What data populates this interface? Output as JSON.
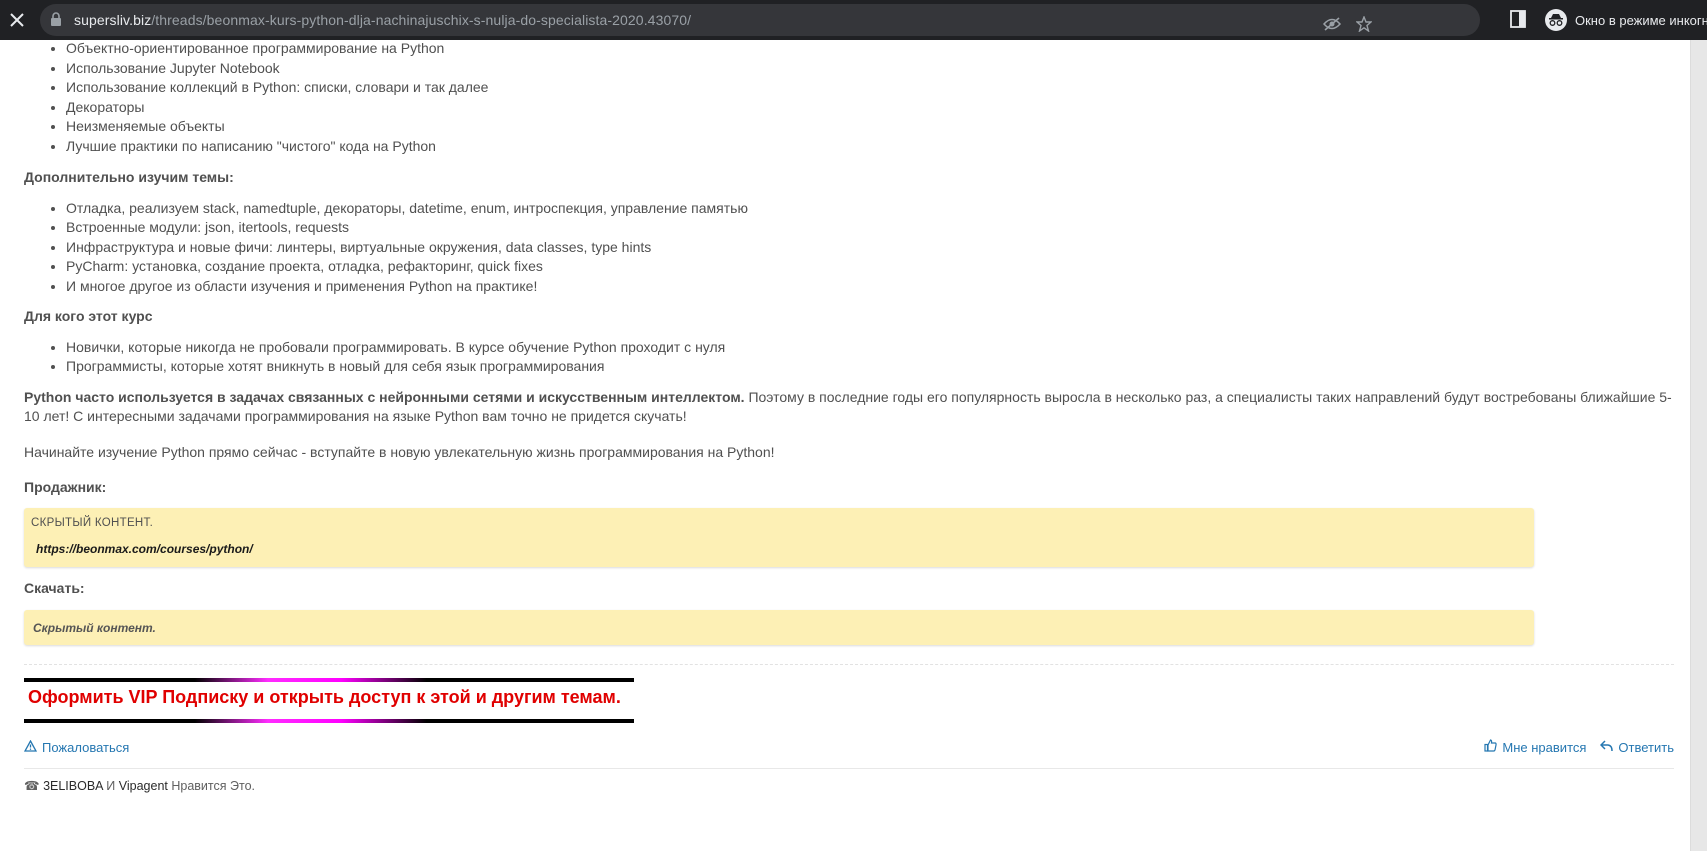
{
  "browser": {
    "url_host": "supersliv.biz",
    "url_path": "/threads/beonmax-kurs-python-dlja-nachinajuschix-s-nulja-do-specialista-2020.43070/",
    "incognito_label": "Окно в режиме инкогни"
  },
  "article": {
    "list1": [
      "Объектно-ориентированное программирование на Python",
      "Использование Jupyter Notebook",
      "Использование коллекций в Python: списки, словари и так далее",
      "Декораторы",
      "Неизменяемые объекты",
      "Лучшие практики по написанию \"чистого\" кода на Python"
    ],
    "extra_heading": "Дополнительно изучим темы:",
    "list2": [
      "Отладка, реализуем stack, namedtuple, декораторы, datetime, enum, интроспекция, управление памятью",
      "Встроенные модули: json, itertools, requests",
      "Инфраструктура и новые фичи: линтеры, виртуальные окружения, data classes, type hints",
      "PyCharm: установка, создание проекта, отладка, рефакторинг, quick fixes",
      "И многое другое из области изучения и применения Python на практике!"
    ],
    "audience_heading": "Для кого этот курс",
    "list3": [
      "Новички, которые никогда не пробовали программировать. В курсе обучение Python проходит с нуля",
      "Программисты, которые хотят вникнуть в новый для себя язык программирования"
    ],
    "para1_bold": "Python часто используется в задачах связанных с нейронными сетями и искусственным интеллектом.",
    "para1_rest": " Поэтому в последние годы его популярность выросла в несколько раз, а специалисты таких направлений будут востребованы ближайшие 5-10 лет! С интересными задачами программирования на языке Python вам точно не придется скучать!",
    "para2": "Начинайте изучение Python прямо сейчас - вступайте в новую увлекательную жизнь программирования на Python!",
    "seller_heading": "Продажник:",
    "spoiler1_title": "СКРЫТЫЙ КОНТЕНТ.",
    "spoiler1_link": "https://beonmax.com/courses/python/",
    "download_heading": "Скачать:",
    "spoiler2_text": "Скрытый контент."
  },
  "vip_text": "Оформить VIP Подписку и открыть доступ к этой и другим темам.",
  "actions": {
    "report": "Пожаловаться",
    "like": "Мне нравится",
    "reply": "Ответить"
  },
  "likes": {
    "user1": "3ELIBOBA",
    "conj": " И ",
    "user2": "Vipagent",
    "suffix": " Нравится Это."
  },
  "colors": {
    "accent_link": "#2577b1",
    "spoiler_bg": "#fdf0b5",
    "vip_red": "#e00000"
  }
}
